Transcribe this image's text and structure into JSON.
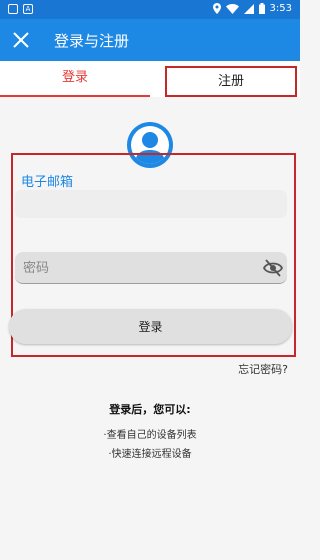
{
  "status_bar": {
    "time": "3:53",
    "icons": [
      "notification-box-icon",
      "a-badge-icon",
      "location-icon",
      "wifi-icon",
      "signal-icon",
      "battery-icon"
    ]
  },
  "app_bar": {
    "title": "登录与注册",
    "close_icon": "close-icon",
    "color": "#1e88e5"
  },
  "tabs": [
    {
      "label": "登录",
      "active": true,
      "color": "#e53935"
    },
    {
      "label": "注册",
      "active": false
    }
  ],
  "form": {
    "email_label": "电子邮箱",
    "email_value": "",
    "password_placeholder": "密码",
    "password_value": "",
    "password_toggle_icon": "eye-off-icon",
    "login_button": "登录",
    "forgot_password": "忘记密码?"
  },
  "after_login": {
    "title": "登录后，您可以:",
    "items": [
      "·查看自己的设备列表",
      "·快速连接远程设备"
    ]
  },
  "colors": {
    "primary": "#1e88e5",
    "accent_red": "#e53935",
    "highlight_frame": "#c62828"
  }
}
